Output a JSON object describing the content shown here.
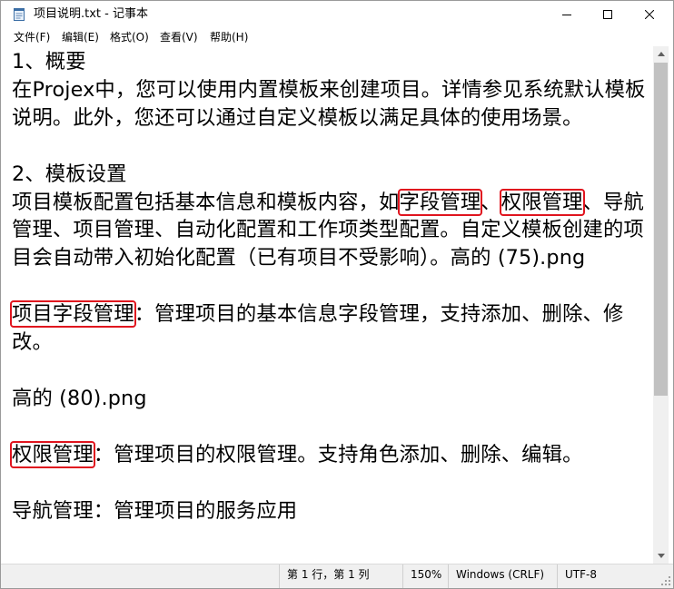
{
  "window": {
    "title": "项目说明.txt - 记事本"
  },
  "menu": [
    "文件(F)",
    "编辑(E)",
    "格式(O)",
    "查看(V)",
    "帮助(H)"
  ],
  "document": {
    "h1": "1、概要",
    "p1": "在Projex中，您可以使用内置模板来创建项目。详情参见系统默认模板说明。此外，您还可以通过自定义模板以满足具体的使用场景。",
    "h2": "2、模板设置",
    "p2_a": "项目模板配置包括基本信息和模板内容，如",
    "p2_hl1": "字段管理",
    "p2_b": "、",
    "p2_hl2": "权限管理",
    "p2_c": "、导航管理、项目管理、自动化配置和工作项类型配置。自定义模板创建的项目会自动带入初始化配置（已有项目不受影响）。高的 (75).png",
    "s1_hl": "项目字段管理",
    "s1_rest": "：管理项目的基本信息字段管理，支持添加、删除、修改。",
    "img2": "高的 (80).png",
    "s2_hl": "权限管理",
    "s2_rest": "：管理项目的权限管理。支持角色添加、删除、编辑。",
    "s3": "导航管理：管理项目的服务应用"
  },
  "status": {
    "position": "第 1 行，第 1 列",
    "zoom": "150%",
    "line_ending": "Windows (CRLF)",
    "encoding": "UTF-8"
  }
}
